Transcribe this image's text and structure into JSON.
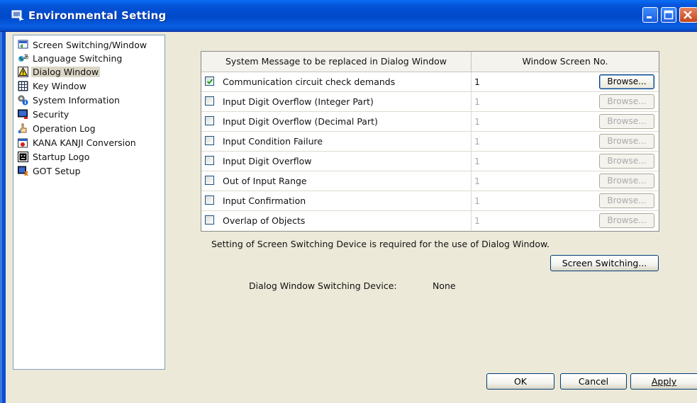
{
  "window": {
    "title": "Environmental Setting"
  },
  "tree": {
    "items": [
      {
        "label": "Screen Switching/Window",
        "icon": "screen-switching-icon",
        "selected": false
      },
      {
        "label": "Language Switching",
        "icon": "language-icon",
        "selected": false
      },
      {
        "label": "Dialog Window",
        "icon": "warning-icon",
        "selected": true
      },
      {
        "label": "Key Window",
        "icon": "keypad-icon",
        "selected": false
      },
      {
        "label": "System Information",
        "icon": "gears-info-icon",
        "selected": false
      },
      {
        "label": "Security",
        "icon": "security-icon",
        "selected": false
      },
      {
        "label": "Operation Log",
        "icon": "operation-log-icon",
        "selected": false
      },
      {
        "label": "KANA KANJI Conversion",
        "icon": "kana-kanji-icon",
        "selected": false
      },
      {
        "label": "Startup Logo",
        "icon": "startup-logo-icon",
        "selected": false
      },
      {
        "label": "GOT Setup",
        "icon": "got-setup-icon",
        "selected": false
      }
    ]
  },
  "table": {
    "headers": [
      "System Message to be replaced in Dialog Window",
      "Window Screen No."
    ],
    "rows": [
      {
        "message": "Communication circuit check demands",
        "screen_no": "1",
        "checked": true,
        "browse": "Browse..."
      },
      {
        "message": "Input Digit Overflow (Integer Part)",
        "screen_no": "1",
        "checked": false,
        "browse": "Browse..."
      },
      {
        "message": "Input Digit Overflow (Decimal Part)",
        "screen_no": "1",
        "checked": false,
        "browse": "Browse..."
      },
      {
        "message": "Input Condition Failure",
        "screen_no": "1",
        "checked": false,
        "browse": "Browse..."
      },
      {
        "message": "Input Digit Overflow",
        "screen_no": "1",
        "checked": false,
        "browse": "Browse..."
      },
      {
        "message": "Out of Input Range",
        "screen_no": "1",
        "checked": false,
        "browse": "Browse..."
      },
      {
        "message": "Input Confirmation",
        "screen_no": "1",
        "checked": false,
        "browse": "Browse..."
      },
      {
        "message": "Overlap of Objects",
        "screen_no": "1",
        "checked": false,
        "browse": "Browse..."
      }
    ]
  },
  "notice": "Setting of Screen Switching Device is required for the use of Dialog Window.",
  "screen_switching_button": "Screen Switching...",
  "device": {
    "label": "Dialog Window Switching Device:",
    "value": "None"
  },
  "footer": {
    "ok": "OK",
    "cancel": "Cancel",
    "apply": "Apply"
  }
}
